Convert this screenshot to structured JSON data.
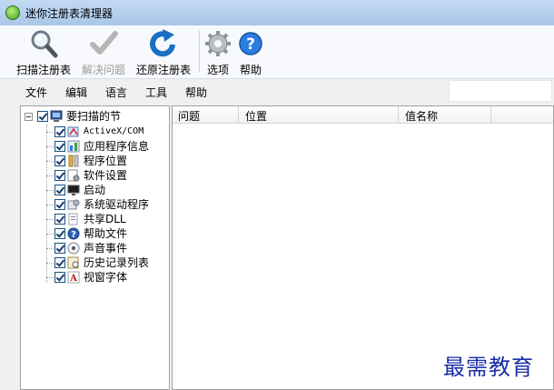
{
  "window": {
    "title": "迷你注册表清理器"
  },
  "toolbar": {
    "scan_label": "扫描注册表",
    "fix_label": "解决问题",
    "restore_label": "还原注册表",
    "options_label": "选项",
    "help_label": "帮助"
  },
  "menu": {
    "items": [
      "文件",
      "编辑",
      "语言",
      "工具",
      "帮助"
    ]
  },
  "tree": {
    "root_label": "要扫描的节",
    "items": [
      {
        "label": "ActiveX/COM",
        "icon": "activex-icon",
        "checked": true
      },
      {
        "label": "应用程序信息",
        "icon": "app-info-icon",
        "checked": true
      },
      {
        "label": "程序位置",
        "icon": "program-location-icon",
        "checked": true
      },
      {
        "label": "软件设置",
        "icon": "software-settings-icon",
        "checked": true
      },
      {
        "label": "启动",
        "icon": "startup-icon",
        "checked": true
      },
      {
        "label": "系统驱动程序",
        "icon": "system-drivers-icon",
        "checked": true
      },
      {
        "label": "共享DLL",
        "icon": "shared-dll-icon",
        "checked": true
      },
      {
        "label": "帮助文件",
        "icon": "help-files-icon",
        "checked": true
      },
      {
        "label": "声音事件",
        "icon": "sound-events-icon",
        "checked": true
      },
      {
        "label": "历史记录列表",
        "icon": "history-list-icon",
        "checked": true
      },
      {
        "label": "视窗字体",
        "icon": "windows-fonts-icon",
        "checked": true
      }
    ]
  },
  "list": {
    "columns": [
      "问题",
      "位置",
      "值名称"
    ]
  },
  "watermark": "最需教育",
  "colors": {
    "titlebar": "#b5d0ee",
    "accent": "#1a6fc4",
    "watermark": "#1b2ea8"
  }
}
